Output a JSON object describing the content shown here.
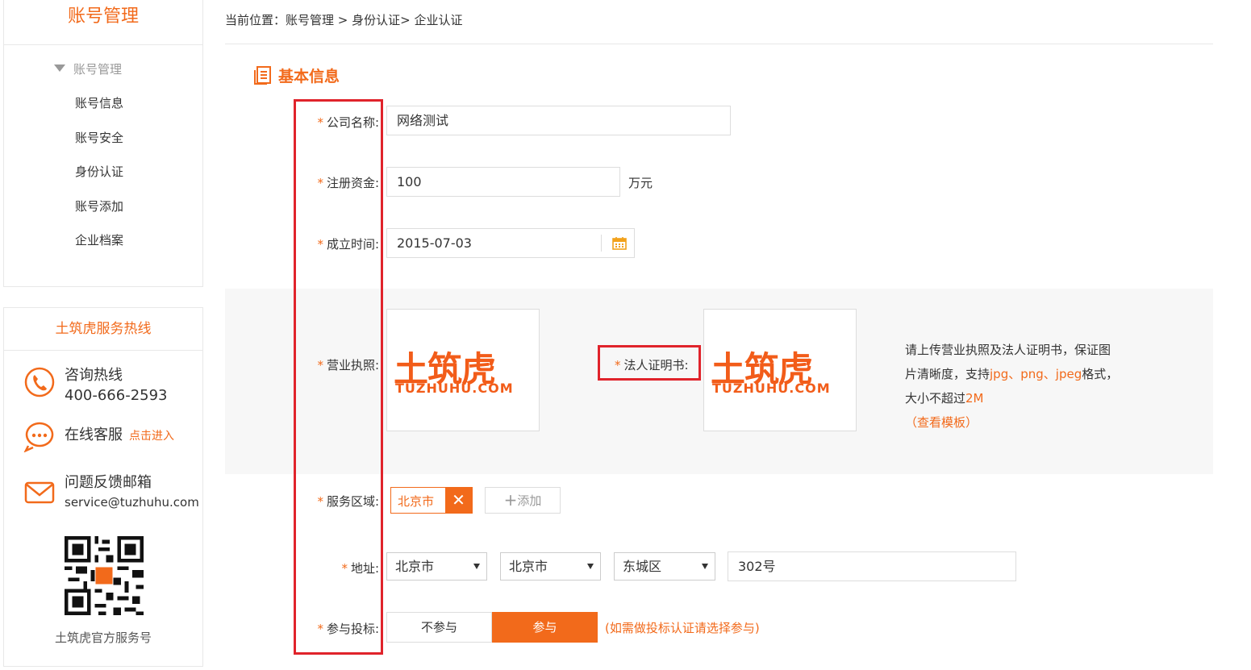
{
  "sidebar": {
    "title": "账号管理",
    "group_label": "账号管理",
    "items": [
      "账号信息",
      "账号安全",
      "身份认证",
      "账号添加",
      "企业档案"
    ],
    "service_title": "土筑虎服务热线",
    "hotline_label": "咨询热线",
    "hotline_number": "400-666-2593",
    "online_label": "在线客服",
    "online_link": "点击进入",
    "email_label": "问题反馈邮箱",
    "email_value": "service@tuzhuhu.com",
    "qr_caption": "土筑虎官方服务号"
  },
  "breadcrumb": "当前位置：账号管理 > 身份认证> 企业认证",
  "section_title": "基本信息",
  "form": {
    "company_label": "公司名称:",
    "company_value": "网络测试",
    "capital_label": "注册资金:",
    "capital_value": "100",
    "capital_unit": "万元",
    "founded_label": "成立时间:",
    "founded_value": "2015-07-03",
    "license_label": "营业执照:",
    "legal_label": "法人证明书:",
    "logo_cn": "土筑虎",
    "logo_en": "TUZHUHU.COM",
    "hint_line1": "请上传营业执照及法人证明书，保证图",
    "hint_line2a": "片清晰度，支持",
    "hint_formats": "jpg、png、jpeg",
    "hint_line2b": "格式，",
    "hint_line3a": "大小不超过",
    "hint_size": "2M",
    "hint_template": "（查看模板）",
    "area_label": "服务区域:",
    "area_tag": "北京市",
    "area_add": "添加",
    "address_label": "地址:",
    "province": "北京市",
    "city": "北京市",
    "district": "东城区",
    "street": "302号",
    "bid_label": "参与投标:",
    "bid_no": "不参与",
    "bid_yes": "参与",
    "bid_note": "(如需做投标认证请选择参与)"
  },
  "colors": {
    "accent": "#f26a1b",
    "highlight": "#e0232b"
  }
}
